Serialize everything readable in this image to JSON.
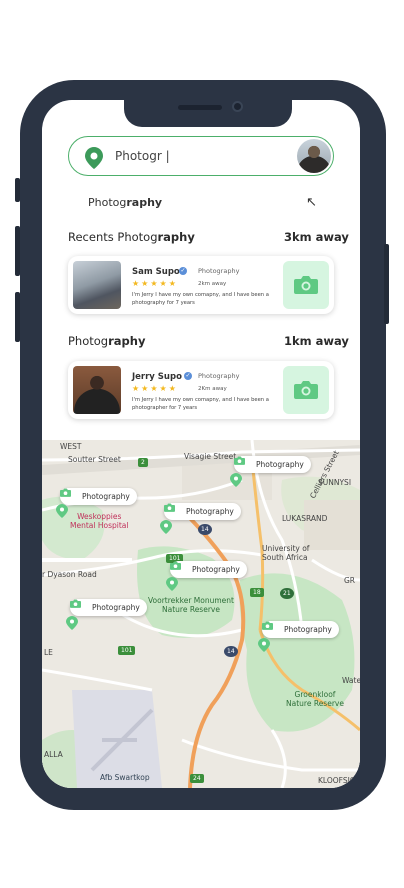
{
  "search": {
    "value": "Photogr |"
  },
  "suggestion": {
    "normal": "Photog",
    "bold": "raphy"
  },
  "recents": {
    "title_normal": "Recents Photog",
    "title_bold": "raphy",
    "distance": "3km away",
    "card": {
      "name": "Sam Supo",
      "verified": "✓",
      "category": "Photography",
      "stars": "★★★★★",
      "distance": "2km away",
      "description": "I'm Jerry I have my own comapny, and I have been a photography for 7 years"
    }
  },
  "nearby": {
    "title_normal": "Photog",
    "title_bold": "raphy",
    "distance": "1km away",
    "card": {
      "name": "Jerry Supo",
      "verified": "✓",
      "category": "Photography",
      "stars": "★★★★★",
      "distance": "2Km away",
      "description": "I'm Jerry I have my own comapny, and I have been a photographer for 7 years"
    }
  },
  "map": {
    "pill_label": "Photography",
    "labels": {
      "west": "WEST",
      "soutter": "Soutter Street",
      "visagie": "Visagie Street",
      "celliers": "Celliers Street",
      "sunnyside": "SUNNYSI",
      "weskoppies": "Weskoppies\nMental Hospital",
      "lukasrand": "LUKASRAND",
      "dyason": "r Dyason Road",
      "unisa": "University of\nSouth Africa",
      "voortrekker": "Voortrekker Monument\nNature Reserve",
      "gr": "GR",
      "le": "LE",
      "groenkloof": "Groenkloof\nNature Reserve",
      "wate": "Wate",
      "afb": "Afb Swartkop",
      "alla": "ALLA",
      "kloofsig": "KLOOFSIG",
      "r2": "2",
      "r101a": "101",
      "r101b": "101",
      "r14a": "14",
      "r14b": "14",
      "r18": "18",
      "r21": "21",
      "r24": "24"
    }
  },
  "colors": {
    "accent": "#4caf6a",
    "camera_tile": "#d6f5e0",
    "star": "#f3b81f",
    "frame": "#2b3444"
  }
}
